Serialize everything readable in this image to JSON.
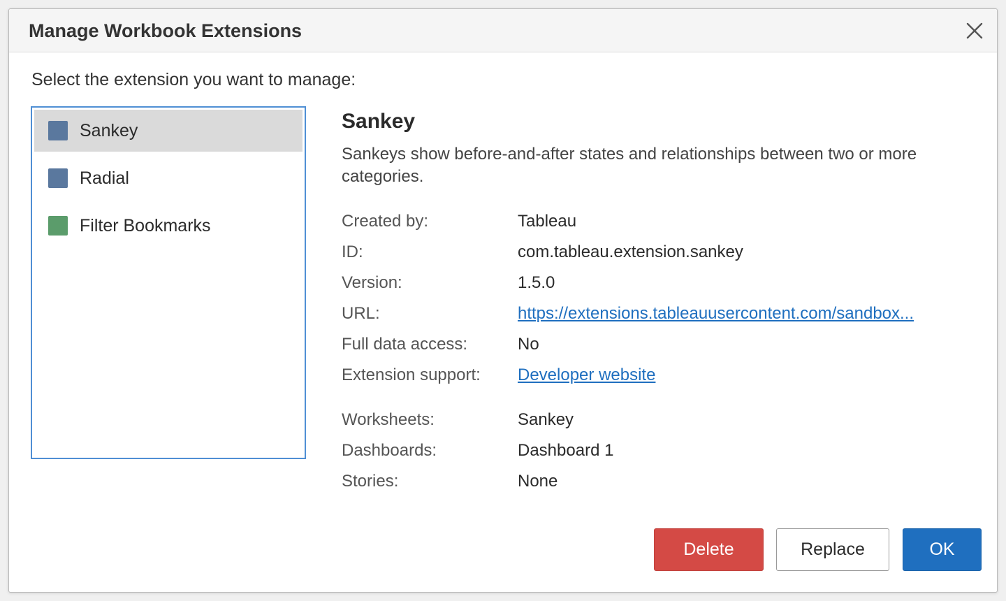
{
  "dialog": {
    "title": "Manage Workbook Extensions",
    "prompt": "Select the extension you want to manage:"
  },
  "extensions": [
    {
      "label": "Sankey",
      "color": "#5a789e",
      "selected": true
    },
    {
      "label": "Radial",
      "color": "#5a789e",
      "selected": false
    },
    {
      "label": "Filter Bookmarks",
      "color": "#5b9c6b",
      "selected": false
    }
  ],
  "details": {
    "name": "Sankey",
    "description": "Sankeys show before-and-after states and relationships between two or more categories.",
    "created_by_label": "Created by:",
    "created_by": "Tableau",
    "id_label": "ID:",
    "id": "com.tableau.extension.sankey",
    "version_label": "Version:",
    "version": "1.5.0",
    "url_label": "URL:",
    "url": "https://extensions.tableauusercontent.com/sandbox...",
    "data_access_label": "Full data access:",
    "data_access": "No",
    "support_label": "Extension support:",
    "support": "Developer website",
    "worksheets_label": "Worksheets:",
    "worksheets": "Sankey",
    "dashboards_label": "Dashboards:",
    "dashboards": "Dashboard 1",
    "stories_label": "Stories:",
    "stories": "None"
  },
  "buttons": {
    "delete": "Delete",
    "replace": "Replace",
    "ok": "OK"
  },
  "colors": {
    "accent": "#1f6fbf",
    "danger": "#d44a45",
    "list_border": "#4f8fd4",
    "selection": "#dadada"
  },
  "icons": {
    "close": "close-icon"
  }
}
